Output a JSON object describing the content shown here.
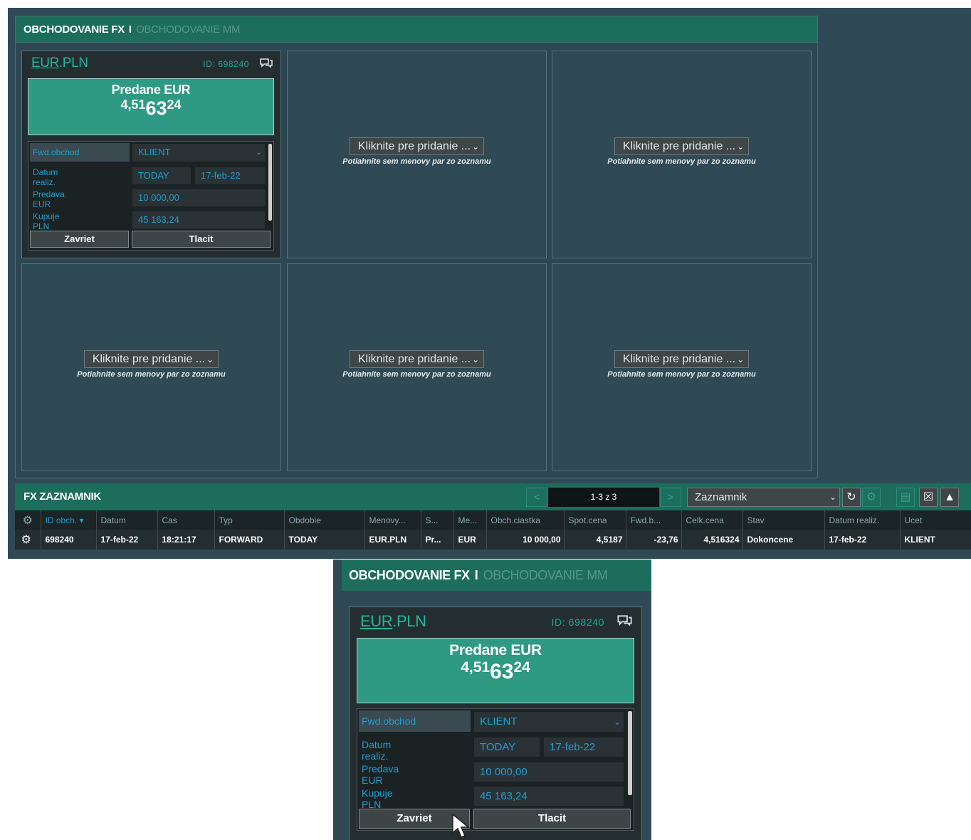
{
  "tabs": {
    "active": "OBCHODOVANIE FX",
    "separator": "I",
    "inactive": "OBCHODOVANIE MM"
  },
  "ticket": {
    "pair_base": "EUR",
    "pair_rest": ".PLN",
    "deal_id": "ID: 698240",
    "side_label": "Predane EUR",
    "price_small": "4,51",
    "price_big": "63",
    "price_pip": "24",
    "fwd_label": "Fwd.obchod",
    "account": "KLIENT",
    "date_label": "Datum realiz.",
    "date_tenor": "TODAY",
    "date_value": "17-feb-22",
    "sell_label": "Predava EUR",
    "sell_amount": "10 000,00",
    "buy_label": "Kupuje PLN",
    "buy_amount": "45 163,24",
    "close_button": "Zavriet",
    "print_button": "Tlacit"
  },
  "placeholder": {
    "add_label": "Kliknite pre pridanie ...",
    "hint": "Potiahnite sem menovy par zo zoznamu"
  },
  "log": {
    "title": "FX ZAZNAMNIK",
    "pager_info": "1-3 z 3",
    "pager_prev": "<",
    "pager_next": ">",
    "view_select": "Zaznamnik",
    "columns": [
      "ID obch.",
      "Datum",
      "Cas",
      "Typ",
      "Obdobie",
      "Menovy...",
      "S...",
      "Me...",
      "Obch.ciastka",
      "Spot.cena",
      "Fwd.b...",
      "Celk.cena",
      "Stav",
      "Datum realiz.",
      "Ucet"
    ],
    "sort_indicator": "▾",
    "rows": [
      [
        "698240",
        "17-feb-22",
        "18:21:17",
        "FORWARD",
        "TODAY",
        "EUR.PLN",
        "Pr...",
        "EUR",
        "10 000,00",
        "4,5187",
        "-23,76",
        "4,516324",
        "Dokoncene",
        "17-feb-22",
        "KLIENT"
      ]
    ]
  },
  "icons": {
    "chat": "chat-bubbles-icon",
    "gear": "gear-icon",
    "refresh": "refresh-icon",
    "print": "print-icon",
    "excel": "excel-export-icon",
    "upload": "upload-icon",
    "chevron": "chevron-down-icon",
    "cursor": "mouse-cursor-icon"
  },
  "colors": {
    "accent_green": "#1c6d5c",
    "price_panel": "#2e9a83",
    "link_blue": "#1f9ed3",
    "background": "#2f4a55"
  }
}
